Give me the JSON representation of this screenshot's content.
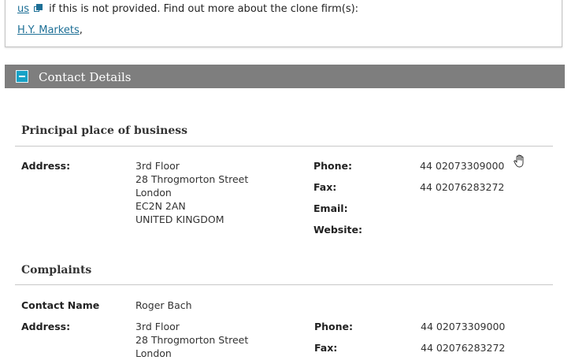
{
  "notice": {
    "contact_link": "us",
    "text_after_icon": " if this is not provided. Find out more about the clone firm(s):",
    "firm_link": "H.Y. Markets",
    "firm_link_suffix": ","
  },
  "contact_section": {
    "title": "Contact Details",
    "principal": {
      "heading": "Principal place of business",
      "address_label": "Address:",
      "address_lines": [
        "3rd Floor",
        "28 Throgmorton Street",
        "London",
        "EC2N 2AN",
        "UNITED KINGDOM"
      ],
      "phone_label": "Phone:",
      "phone": "44 02073309000",
      "fax_label": "Fax:",
      "fax": "44 02076283272",
      "email_label": "Email:",
      "website_label": "Website:"
    },
    "complaints": {
      "heading": "Complaints",
      "contact_name_label": "Contact Name",
      "contact_name": "Roger Bach",
      "address_label": "Address:",
      "address_lines": [
        "3rd Floor",
        "28 Throgmorton Street",
        "London"
      ],
      "phone_label": "Phone:",
      "phone": "44 02073309000",
      "fax_label": "Fax:",
      "fax": "44 02076283272"
    }
  },
  "icons": {
    "external_link": "external-link-icon",
    "collapse": "collapse-icon",
    "cursor": "hand-cursor-icon"
  }
}
